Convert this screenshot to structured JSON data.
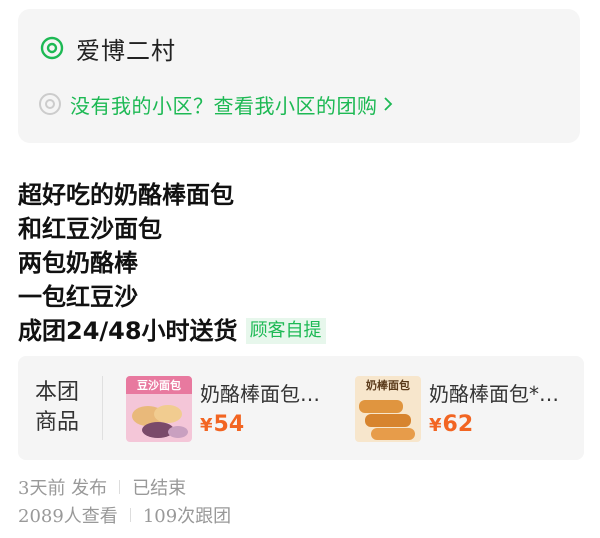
{
  "location": {
    "community_name": "爱博二村",
    "switch_link": "没有我的小区？查看我小区的团购"
  },
  "description": {
    "lines": [
      "超好吃的奶酪棒面包",
      "和红豆沙面包",
      "两包奶酪棒",
      "一包红豆沙",
      "成团24/48小时送货"
    ],
    "pickup_badge": "顾客自提"
  },
  "goods": {
    "label": "本团\n商品",
    "items": [
      {
        "name": "奶酪棒面包…",
        "currency": "¥",
        "price": "54",
        "thumb_text": "豆沙面包"
      },
      {
        "name": "奶酪棒面包*…",
        "currency": "¥",
        "price": "62",
        "thumb_text": "奶棒面包"
      }
    ]
  },
  "meta": {
    "posted": "3天前 发布",
    "status": "已结束",
    "views": "2089人查看",
    "follows": "109次跟团"
  },
  "colors": {
    "accent": "#1db954",
    "price": "#f26522",
    "card_bg": "#f5f5f5"
  }
}
